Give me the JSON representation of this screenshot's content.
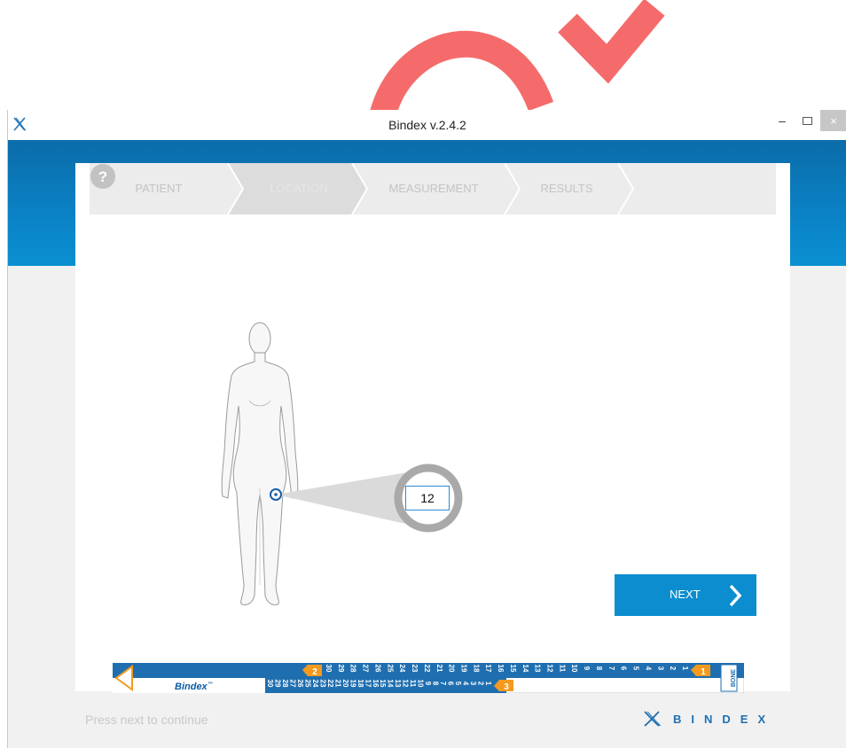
{
  "window": {
    "title": "Bindex v.2.4.2",
    "minimize_symbol": "–",
    "close_symbol": "×"
  },
  "steps": [
    {
      "label": "PATIENT",
      "state": "done"
    },
    {
      "label": "LOCATION",
      "state": "active"
    },
    {
      "label": "MEASUREMENT",
      "state": "pending"
    },
    {
      "label": "RESULTS",
      "state": "pending"
    }
  ],
  "toolbar": {
    "home_icon": "home-icon",
    "help_icon": "help-icon",
    "help_symbol": "?"
  },
  "location": {
    "value": "12",
    "marker_icon": "target-icon"
  },
  "next_button": {
    "label": "NEXT",
    "icon": "chevron-right-icon"
  },
  "ruler": {
    "brand": "Bindex",
    "trademark": "™",
    "zone_markers": [
      "1",
      "2",
      "3"
    ],
    "top_scale": [
      "30",
      "29",
      "28",
      "27",
      "26",
      "25",
      "24",
      "23",
      "22",
      "21",
      "20",
      "19",
      "18",
      "17",
      "16",
      "15",
      "14",
      "13",
      "12",
      "11",
      "10",
      "9",
      "8",
      "7",
      "6",
      "5",
      "4",
      "3",
      "2",
      "1"
    ],
    "bottom_scale": [
      "30",
      "29",
      "28",
      "27",
      "26",
      "25",
      "24",
      "23",
      "22",
      "21",
      "20",
      "19",
      "18",
      "17",
      "16",
      "15",
      "14",
      "13",
      "12",
      "11",
      "10",
      "9",
      "8",
      "7",
      "6",
      "5",
      "4",
      "3",
      "2",
      "1"
    ],
    "end_tag": "BONE"
  },
  "footer": {
    "hint": "Press next to continue",
    "logo_text": "BINDEX"
  },
  "colors": {
    "brand_blue": "#0b8dcf",
    "header_blue": "#0b6ca9",
    "accent_orange": "#f39a1e",
    "watermark_red": "#f56b6b"
  }
}
